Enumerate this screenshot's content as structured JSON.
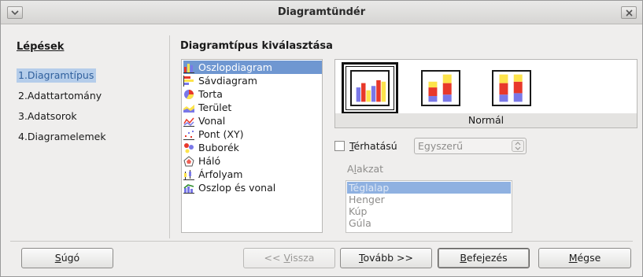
{
  "window": {
    "title": "Diagramtündér"
  },
  "steps": {
    "heading": "Lépések",
    "items": [
      {
        "label": "1.Diagramtípus",
        "active": true
      },
      {
        "label": "2.Adattartomány",
        "active": false
      },
      {
        "label": "3.Adatsorok",
        "active": false
      },
      {
        "label": "4.Diagramelemek",
        "active": false
      }
    ]
  },
  "main": {
    "heading": "Diagramtípus kiválasztása",
    "chart_types": [
      {
        "label": "Oszlopdiagram",
        "icon": "column-chart-icon",
        "selected": true
      },
      {
        "label": "Sávdiagram",
        "icon": "bar-chart-icon",
        "selected": false
      },
      {
        "label": "Torta",
        "icon": "pie-chart-icon",
        "selected": false
      },
      {
        "label": "Terület",
        "icon": "area-chart-icon",
        "selected": false
      },
      {
        "label": "Vonal",
        "icon": "line-chart-icon",
        "selected": false
      },
      {
        "label": "Pont (XY)",
        "icon": "scatter-chart-icon",
        "selected": false
      },
      {
        "label": "Buborék",
        "icon": "bubble-chart-icon",
        "selected": false
      },
      {
        "label": "Háló",
        "icon": "net-chart-icon",
        "selected": false
      },
      {
        "label": "Árfolyam",
        "icon": "stock-chart-icon",
        "selected": false
      },
      {
        "label": "Oszlop és vonal",
        "icon": "column-line-chart-icon",
        "selected": false
      }
    ],
    "variants": {
      "caption": "Normál",
      "items": [
        {
          "icon": "normal-column-icon",
          "selected": true
        },
        {
          "icon": "stacked-column-icon",
          "selected": false
        },
        {
          "icon": "percent-stacked-column-icon",
          "selected": false
        }
      ]
    },
    "three_d": {
      "label_pre": "T",
      "label_post": "érhatású",
      "checked": false,
      "combo_value": "Egyszerű"
    },
    "shape": {
      "label_pre": "A",
      "label_under": "l",
      "label_post": "akzat",
      "items": [
        {
          "label": "Téglalap",
          "selected": true
        },
        {
          "label": "Henger",
          "selected": false
        },
        {
          "label": "Kúp",
          "selected": false
        },
        {
          "label": "Gúla",
          "selected": false
        }
      ]
    }
  },
  "buttons": {
    "help": {
      "u": "S",
      "rest": "úgó"
    },
    "back": {
      "pre": "<< ",
      "u": "V",
      "rest": "issza"
    },
    "next": {
      "u": "T",
      "rest": "ovább >>"
    },
    "finish": {
      "u": "B",
      "rest": "efejezés"
    },
    "cancel": {
      "u": "M",
      "rest": "égse"
    }
  },
  "colors": {
    "selection": "#6f97d1",
    "step_highlight": "#b5cdea",
    "bar_red": "#e8382a",
    "bar_yellow": "#fde34b",
    "bar_blue": "#7a78e8"
  }
}
